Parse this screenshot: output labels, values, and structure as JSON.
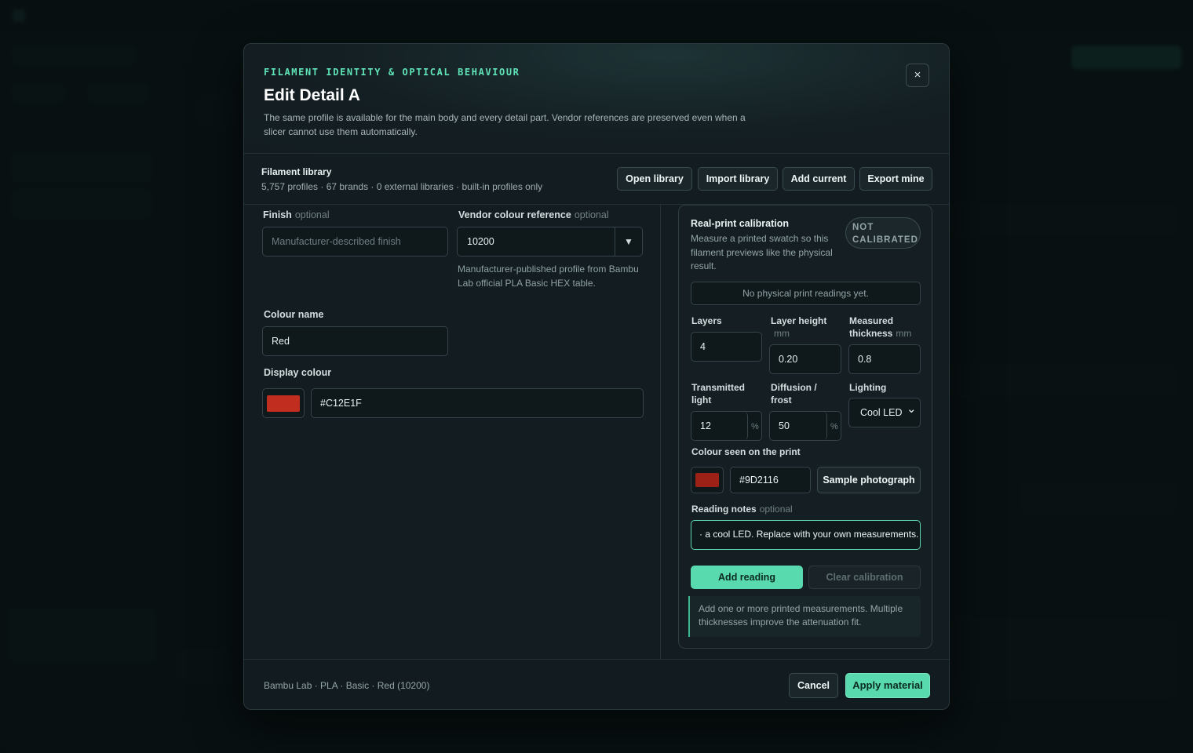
{
  "colors": {
    "accent": "#59d9ae",
    "display_swatch": "#C12E1F",
    "print_swatch": "#9D2116"
  },
  "modal": {
    "eyebrow": "FILAMENT IDENTITY & OPTICAL BEHAVIOUR",
    "title": "Edit Detail A",
    "description": "The same profile is available for the main body and every detail part. Vendor references are preserved even when a slicer cannot use them automatically.",
    "close_icon": "×"
  },
  "library": {
    "title": "Filament library",
    "meta": "5,757 profiles · 67 brands · 0 external libraries · built-in profiles only",
    "buttons": [
      "Open library",
      "Import library",
      "Add current",
      "Export mine"
    ]
  },
  "form": {
    "finish_label": "Finish",
    "optional": "optional",
    "finish_placeholder": "Manufacturer-described finish",
    "vendor_ref_label": "Vendor colour reference",
    "vendor_ref_value": "10200",
    "dropdown_icon": "▼",
    "vendor_help": "Manufacturer-published profile from Bambu Lab official PLA Basic HEX table.",
    "colour_name_label": "Colour name",
    "colour_name_value": "Red",
    "display_colour_label": "Display colour",
    "display_colour_value": "#C12E1F"
  },
  "calibration": {
    "title": "Real-print calibration",
    "description": "Measure a printed swatch so this filament previews like the physical result.",
    "status_badge": "NOT CALIBRATED",
    "no_readings": "No physical print readings yet.",
    "layers_label": "Layers",
    "layers_value": "4",
    "layer_height_label": "Layer height",
    "layer_height_unit": "mm",
    "layer_height_value": "0.20",
    "thickness_label": "Measured thickness",
    "thickness_unit": "mm",
    "thickness_value": "0.8",
    "transmitted_label": "Transmitted light",
    "transmitted_value": "12",
    "diffusion_label": "Diffusion / frost",
    "diffusion_value": "50",
    "percent": "%",
    "lighting_label": "Lighting",
    "lighting_value": "Cool LED",
    "lighting_icon": "⌄",
    "seen_label": "Colour seen on the print",
    "seen_value": "#9D2116",
    "sample_button": "Sample photograph",
    "notes_label": "Reading notes",
    "notes_value": "· a cool LED. Replace with your own measurements.",
    "add_reading": "Add reading",
    "clear_calibration": "Clear calibration",
    "info": "Add one or more printed measurements. Multiple thicknesses improve the attenuation fit."
  },
  "footer": {
    "summary": "Bambu Lab · PLA · Basic · Red (10200)",
    "cancel": "Cancel",
    "apply": "Apply material"
  }
}
